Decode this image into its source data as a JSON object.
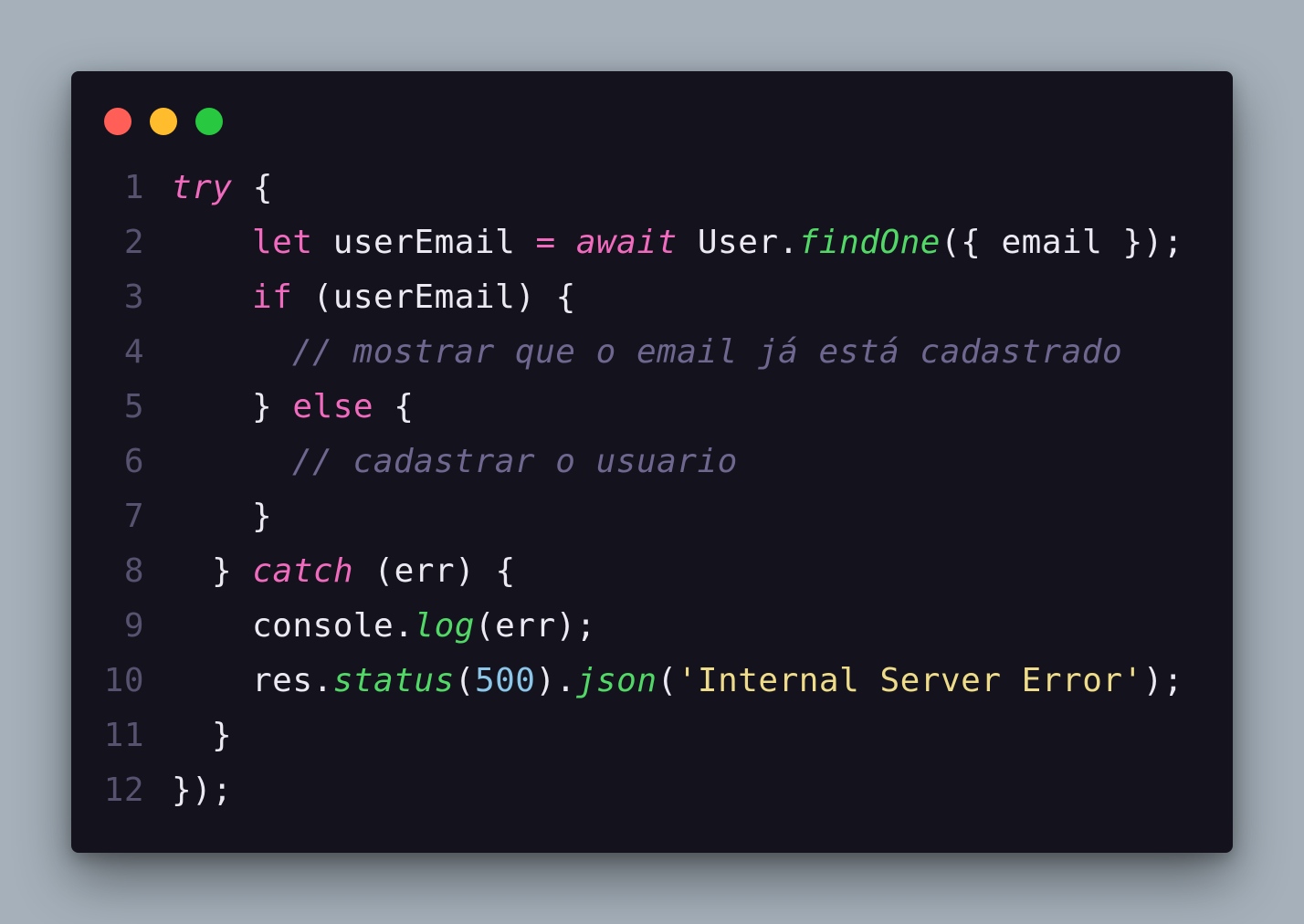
{
  "window": {
    "controls": [
      {
        "name": "close-button",
        "color": "#ff5f57"
      },
      {
        "name": "minimize-button",
        "color": "#ffbd2e"
      },
      {
        "name": "maximize-button",
        "color": "#28c840"
      }
    ]
  },
  "code": {
    "lines": [
      {
        "num": "1",
        "indent": 0,
        "tokens": [
          [
            "kwi",
            "try"
          ],
          [
            "pl",
            " {"
          ]
        ]
      },
      {
        "num": "2",
        "indent": 2,
        "tokens": [
          [
            "kw",
            "let"
          ],
          [
            "pl",
            " userEmail "
          ],
          [
            "kw",
            "="
          ],
          [
            "pl",
            " "
          ],
          [
            "kwi",
            "await"
          ],
          [
            "pl",
            " User."
          ],
          [
            "fn",
            "findOne"
          ],
          [
            "pl",
            "({ email });"
          ]
        ]
      },
      {
        "num": "3",
        "indent": 2,
        "tokens": [
          [
            "kw",
            "if"
          ],
          [
            "pl",
            " (userEmail) {"
          ]
        ]
      },
      {
        "num": "4",
        "indent": 3,
        "tokens": [
          [
            "cm",
            "// mostrar que o email já está cadastrado"
          ]
        ]
      },
      {
        "num": "5",
        "indent": 2,
        "tokens": [
          [
            "pl",
            "} "
          ],
          [
            "kw",
            "else"
          ],
          [
            "pl",
            " {"
          ]
        ]
      },
      {
        "num": "6",
        "indent": 3,
        "tokens": [
          [
            "cm",
            "// cadastrar o usuario"
          ]
        ]
      },
      {
        "num": "7",
        "indent": 2,
        "tokens": [
          [
            "pl",
            "}"
          ]
        ]
      },
      {
        "num": "8",
        "indent": 1,
        "tokens": [
          [
            "pl",
            "} "
          ],
          [
            "kwi",
            "catch"
          ],
          [
            "pl",
            " (err) {"
          ]
        ]
      },
      {
        "num": "9",
        "indent": 2,
        "tokens": [
          [
            "pl",
            "console."
          ],
          [
            "fn",
            "log"
          ],
          [
            "pl",
            "(err);"
          ]
        ]
      },
      {
        "num": "10",
        "indent": 2,
        "tokens": [
          [
            "pl",
            "res."
          ],
          [
            "fn",
            "status"
          ],
          [
            "pl",
            "("
          ],
          [
            "num",
            "500"
          ],
          [
            "pl",
            ")."
          ],
          [
            "fn",
            "json"
          ],
          [
            "pl",
            "("
          ],
          [
            "str",
            "'Internal Server Error'"
          ],
          [
            "pl",
            ");"
          ]
        ]
      },
      {
        "num": "11",
        "indent": 1,
        "tokens": [
          [
            "pl",
            "}"
          ]
        ]
      },
      {
        "num": "12",
        "indent": 0,
        "tokens": [
          [
            "pl",
            "});"
          ]
        ]
      }
    ]
  }
}
